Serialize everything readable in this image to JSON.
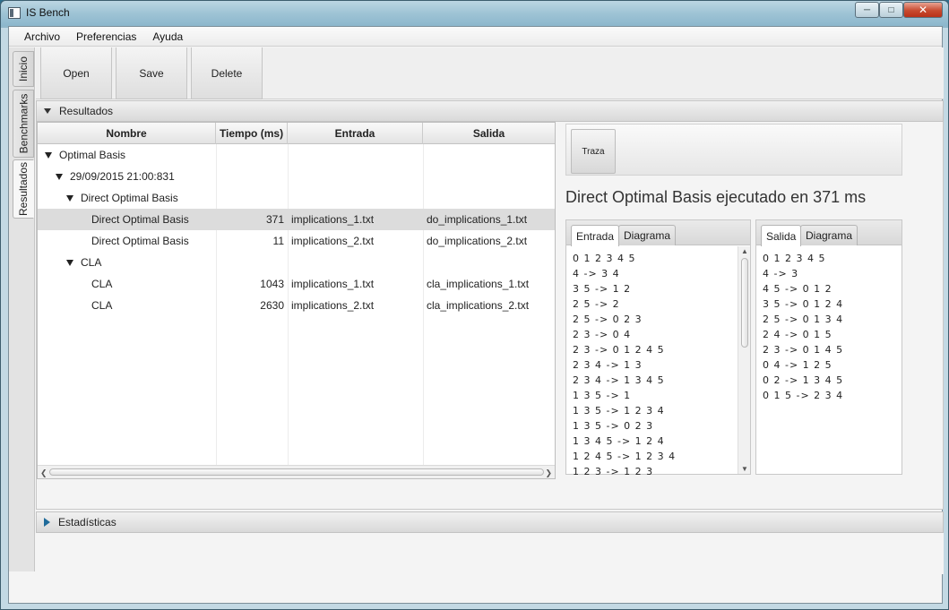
{
  "window": {
    "title": "IS Bench"
  },
  "menu": [
    "Archivo",
    "Preferencias",
    "Ayuda"
  ],
  "side_tabs": [
    "Inicio",
    "Benchmarks",
    "Resultados"
  ],
  "toolbar": {
    "open_label": "Open",
    "save_label": "Save",
    "delete_label": "Delete"
  },
  "results_pane": {
    "title": "Resultados"
  },
  "stats_pane": {
    "title": "Estadísticas"
  },
  "table": {
    "columns": [
      "Nombre",
      "Tiempo (ms)",
      "Entrada",
      "Salida"
    ],
    "rows": [
      {
        "level": 0,
        "expanded": true,
        "name": "Optimal Basis",
        "time": "",
        "input": "",
        "output": ""
      },
      {
        "level": 1,
        "expanded": true,
        "name": "29/09/2015 21:00:831",
        "time": "",
        "input": "",
        "output": ""
      },
      {
        "level": 2,
        "expanded": true,
        "name": "Direct Optimal Basis",
        "time": "",
        "input": "",
        "output": ""
      },
      {
        "level": 3,
        "expanded": false,
        "selected": true,
        "name": "Direct Optimal Basis",
        "time": "371",
        "input": "implications_1.txt",
        "output": "do_implications_1.txt"
      },
      {
        "level": 3,
        "expanded": false,
        "name": "Direct Optimal Basis",
        "time": "11",
        "input": "implications_2.txt",
        "output": "do_implications_2.txt"
      },
      {
        "level": 2,
        "expanded": true,
        "name": "CLA",
        "time": "",
        "input": "",
        "output": ""
      },
      {
        "level": 3,
        "expanded": false,
        "name": "CLA",
        "time": "1043",
        "input": "implications_1.txt",
        "output": "cla_implications_1.txt"
      },
      {
        "level": 3,
        "expanded": false,
        "name": "CLA",
        "time": "2630",
        "input": "implications_2.txt",
        "output": "cla_implications_2.txt"
      }
    ]
  },
  "detail": {
    "trace_label": "Traza",
    "exec_title": "Direct Optimal Basis ejecutado en 371 ms",
    "input_pane": {
      "tabs": [
        "Entrada",
        "Diagrama"
      ],
      "lines": [
        "0 1 2 3 4 5",
        "4 -> 3 4",
        "3 5 -> 1 2",
        "2 5 -> 2",
        "2 5 -> 0 2 3",
        "2 3 -> 0 4",
        "2 3 -> 0 1 2 4 5",
        "2 3 4 -> 1 3",
        "2 3 4 -> 1 3 4 5",
        "1 3 5 -> 1",
        "1 3 5 -> 1 2 3 4",
        "1 3 5 -> 0 2 3",
        "1 3 4 5 -> 1 2 4",
        "1 2 4 5 -> 1 2 3 4",
        "1 2 3 -> 1 2 3"
      ]
    },
    "output_pane": {
      "tabs": [
        "Salida",
        "Diagrama"
      ],
      "lines": [
        "0 1 2 3 4 5",
        "4 -> 3",
        "4 5 -> 0 1 2",
        "3 5 -> 0 1 2 4",
        "2 5 -> 0 1 3 4",
        "2 4 -> 0 1 5",
        "2 3 -> 0 1 4 5",
        "0 4 -> 1 2 5",
        "0 2 -> 1 3 4 5",
        "0 1 5 -> 2 3 4"
      ]
    }
  }
}
